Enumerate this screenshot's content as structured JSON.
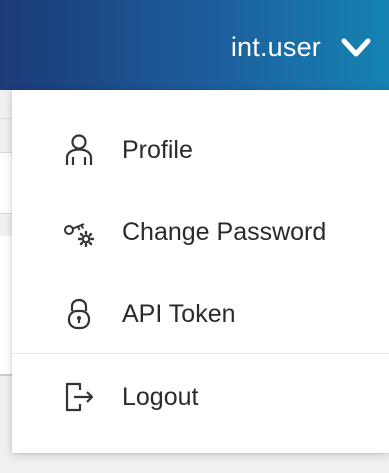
{
  "header": {
    "user_name": "int.user",
    "toggle_icon": "chevron-down-icon",
    "gradient_start": "#1b3a78",
    "gradient_end": "#1583b2"
  },
  "menu": {
    "items": [
      {
        "label": "Profile",
        "icon": "user-icon"
      },
      {
        "label": "Change Password",
        "icon": "key-gear-icon"
      },
      {
        "label": "API Token",
        "icon": "lock-icon"
      },
      {
        "label": "Logout",
        "icon": "logout-icon"
      }
    ]
  }
}
